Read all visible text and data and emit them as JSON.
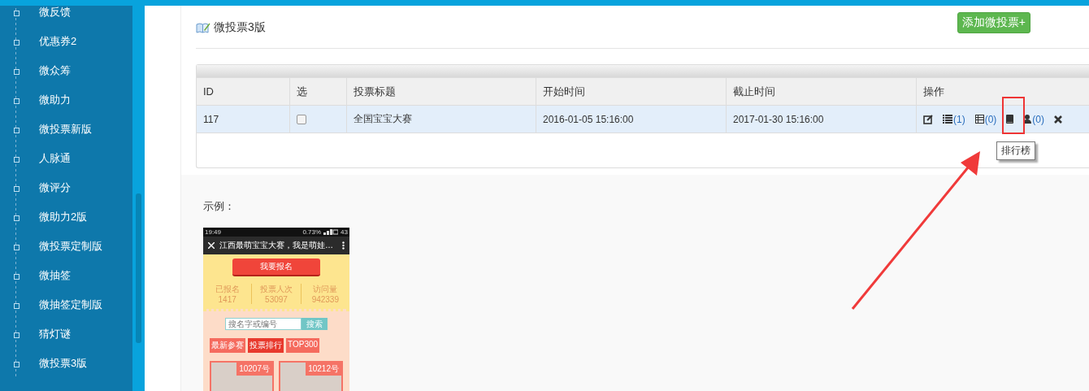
{
  "sidebar": {
    "items": [
      {
        "label": "微反馈"
      },
      {
        "label": "优惠券2"
      },
      {
        "label": "微众筹"
      },
      {
        "label": "微助力"
      },
      {
        "label": "微投票新版"
      },
      {
        "label": "人脉通"
      },
      {
        "label": "微评分"
      },
      {
        "label": "微助力2版"
      },
      {
        "label": "微投票定制版"
      },
      {
        "label": "微抽签"
      },
      {
        "label": "微抽签定制版"
      },
      {
        "label": "猜灯谜"
      },
      {
        "label": "微投票3版"
      }
    ]
  },
  "page": {
    "title": "微投票3版",
    "add_button": "添加微投票+"
  },
  "table": {
    "columns": [
      "ID",
      "选",
      "投票标题",
      "开始时间",
      "截止时间",
      "操作"
    ],
    "rows": [
      {
        "id": "117",
        "checked": false,
        "title": "全国宝宝大赛",
        "start": "2016-01-05 15:16:00",
        "end": "2017-01-30 15:16:00",
        "actions": [
          {
            "kind": "edit"
          },
          {
            "kind": "list",
            "count": "(1)"
          },
          {
            "kind": "table",
            "count": "(0)"
          },
          {
            "kind": "book"
          },
          {
            "kind": "person",
            "count": "(0)"
          },
          {
            "kind": "delete"
          }
        ]
      }
    ]
  },
  "tooltip": "排行榜",
  "example": {
    "label": "示例：",
    "phone": {
      "status": {
        "time": "19:49",
        "speed": "0.73%",
        "battery": "43"
      },
      "title": "江西最萌宝宝大赛，我是萌娃…",
      "signup_button": "我要报名",
      "stats": [
        {
          "label": "已报名",
          "value": "1417"
        },
        {
          "label": "投票人次",
          "value": "53097"
        },
        {
          "label": "访问量",
          "value": "942339"
        }
      ],
      "search": {
        "placeholder": "搜名字或编号",
        "button": "搜索"
      },
      "tabs": [
        {
          "label": "最新参赛",
          "selected": false
        },
        {
          "label": "投票排行",
          "selected": true
        },
        {
          "label": "TOP300",
          "selected": false
        }
      ],
      "entries": [
        {
          "badge": "10207号"
        },
        {
          "badge": "10212号"
        }
      ]
    }
  }
}
